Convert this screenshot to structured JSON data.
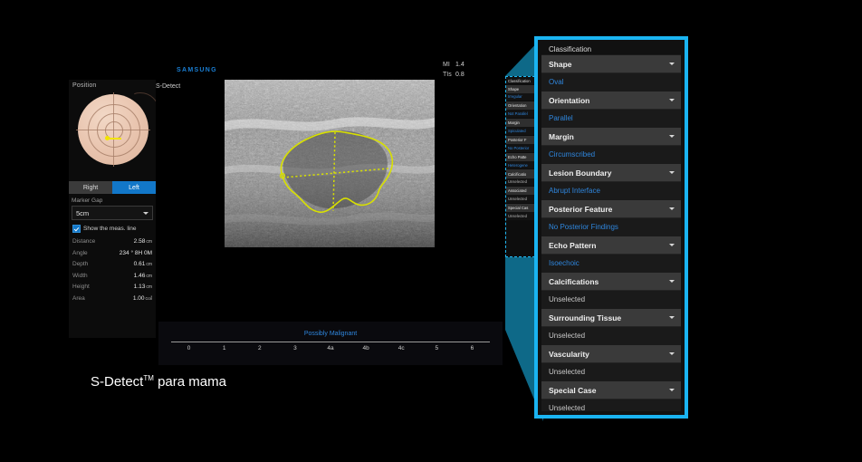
{
  "caption": {
    "text": "S-Detect",
    "sup": "TM",
    "suffix": " para mama"
  },
  "machine": {
    "brand": "SAMSUNG",
    "mode_label": "S-Detect",
    "mi_key": "MI",
    "mi_value": "1.4",
    "tis_key": "TIs",
    "tis_value": "0.8"
  },
  "position_panel": {
    "title": "Position",
    "side_right": "Right",
    "side_left": "Left",
    "marker_gap_label": "Marker Gap",
    "marker_gap_value": "5cm",
    "show_meas_line": "Show the meas. line",
    "measurements": [
      {
        "key": "Distance",
        "value": "2.58",
        "unit": "cm"
      },
      {
        "key": "Angle",
        "value": "234 °  8H 0M",
        "unit": ""
      },
      {
        "key": "Depth",
        "value": "0.61",
        "unit": "cm"
      },
      {
        "key": "Width",
        "value": "1.46",
        "unit": "cm"
      },
      {
        "key": "Height",
        "value": "1.13",
        "unit": "cm"
      },
      {
        "key": "Area",
        "value": "1.00",
        "unit": "c㎠"
      }
    ]
  },
  "birads": {
    "title": "Possibly Malignant",
    "ticks": [
      "0",
      "1",
      "2",
      "3",
      "4a",
      "4b",
      "4c",
      "5",
      "6"
    ]
  },
  "mini_panel": {
    "title": "Classification",
    "rows": [
      {
        "label": "Shape",
        "value": "Irregular",
        "unselected": false
      },
      {
        "label": "Orientation",
        "value": "Not Parallel",
        "unselected": false
      },
      {
        "label": "Margin",
        "value": "Spiculated",
        "unselected": false
      },
      {
        "label": "Posterior F",
        "value": "No Posterior",
        "unselected": false
      },
      {
        "label": "Echo Patte",
        "value": "Heterogene",
        "unselected": false
      },
      {
        "label": "Calcificatio",
        "value": "Unselected",
        "unselected": true
      },
      {
        "label": "Associated",
        "value": "Unselected",
        "unselected": true
      },
      {
        "label": "Special Cas",
        "value": "Unselected",
        "unselected": true
      }
    ]
  },
  "zoom_panel": {
    "title": "Classification",
    "rows": [
      {
        "label": "Shape",
        "value": "Oval",
        "unselected": false
      },
      {
        "label": "Orientation",
        "value": "Parallel",
        "unselected": false
      },
      {
        "label": "Margin",
        "value": "Circumscribed",
        "unselected": false
      },
      {
        "label": "Lesion Boundary",
        "value": "Abrupt Interface",
        "unselected": false
      },
      {
        "label": "Posterior Feature",
        "value": "No Posterior Findings",
        "unselected": false
      },
      {
        "label": "Echo Pattern",
        "value": "Isoechoic",
        "unselected": false
      },
      {
        "label": "Calcifications",
        "value": "Unselected",
        "unselected": true
      },
      {
        "label": "Surrounding Tissue",
        "value": "Unselected",
        "unselected": true
      },
      {
        "label": "Vascularity",
        "value": "Unselected",
        "unselected": true
      },
      {
        "label": "Special Case",
        "value": "Unselected",
        "unselected": true
      }
    ]
  },
  "colors": {
    "accent_cyan": "#1ab4f2",
    "accent_blue": "#2f86dd",
    "samsung_blue": "#1a7fd4",
    "selected_blue": "#1277c8",
    "lesion_yellow": "#d8e000"
  }
}
